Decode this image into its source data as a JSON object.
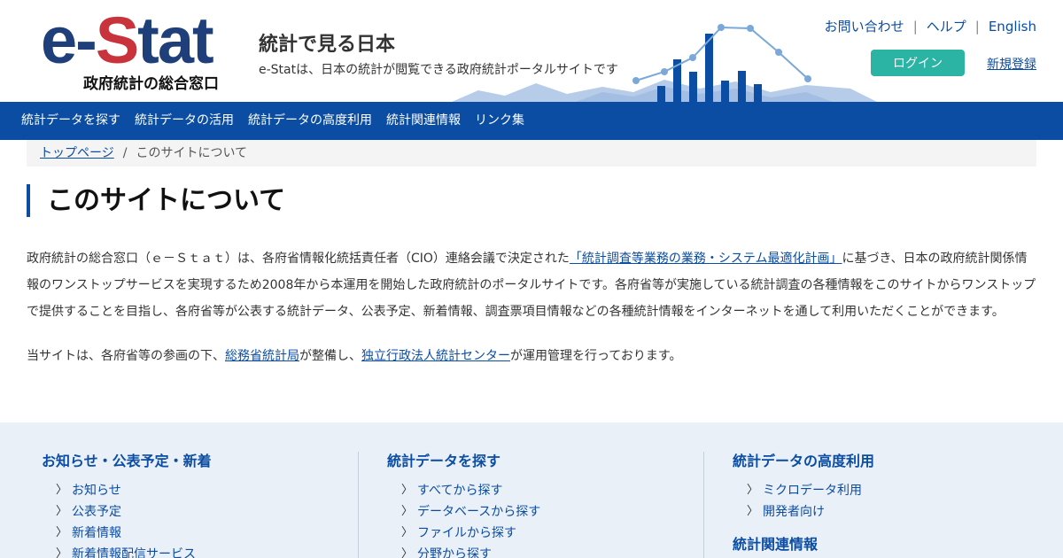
{
  "header": {
    "logo_text_prefix": "e-",
    "logo_text_s": "S",
    "logo_text_suffix": "tat",
    "logo_sub": "政府統計の総合窓口",
    "site_title": "統計で見る日本",
    "site_desc": "e-Statは、日本の統計が閲覧できる政府統計ポータルサイトです",
    "top_links": [
      "お問い合わせ",
      "ヘルプ",
      "English"
    ],
    "top_link_separator": "|",
    "login_label": "ログイン",
    "register_label": "新規登録"
  },
  "nav": {
    "items": [
      "統計データを探す",
      "統計データの活用",
      "統計データの高度利用",
      "統計関連情報",
      "リンク集"
    ]
  },
  "breadcrumb": {
    "home": "トップページ",
    "separator": "/",
    "current": "このサイトについて"
  },
  "main": {
    "title": "このサイトについて",
    "para1_a": "政府統計の総合窓口（ｅ－Ｓｔａｔ）は、各府省情報化統括責任者（CIO）連絡会議で決定された",
    "para1_link": "「統計調査等業務の業務・システム最適化計画」",
    "para1_b": "に基づき、日本の政府統計関係情報のワンストップサービスを実現するため2008年から本運用を開始した政府統計のポータルサイトです。各府省等が実施している統計調査の各種情報をこのサイトからワンストップで提供することを目指し、各府省等が公表する統計データ、公表予定、新着情報、調査票項目情報などの各種統計情報をインターネットを通して利用いただくことができます。",
    "para2_a": "当サイトは、各府省等の参画の下、",
    "para2_link1": "総務省統計局",
    "para2_b": "が整備し、",
    "para2_link2": "独立行政法人統計センター",
    "para2_c": "が運用管理を行っております。"
  },
  "footer": {
    "col1": {
      "heading": "お知らせ・公表予定・新着",
      "items": [
        "お知らせ",
        "公表予定",
        "新着情報",
        "新着情報配信サービス"
      ]
    },
    "col2": {
      "heading": "統計データを探す",
      "items": [
        "すべてから探す",
        "データベースから探す",
        "ファイルから探す",
        "分野から探す"
      ]
    },
    "col3": {
      "heading": "統計データの高度利用",
      "items": [
        "ミクロデータ利用",
        "開発者向け"
      ],
      "heading2": "統計関連情報"
    },
    "chevron": "〉"
  },
  "colors": {
    "brand_blue": "#0b4da2",
    "logo_navy": "#1e3f7a",
    "logo_red": "#c8333c",
    "login_teal": "#2bb3a4",
    "footer_bg": "#eaf0f8",
    "breadcrumb_bg": "#f4f4f4"
  },
  "icons": {
    "header_decoration": "bar-line-chart-skyline-graphic",
    "footer_bullet": "chevron-right-icon"
  }
}
